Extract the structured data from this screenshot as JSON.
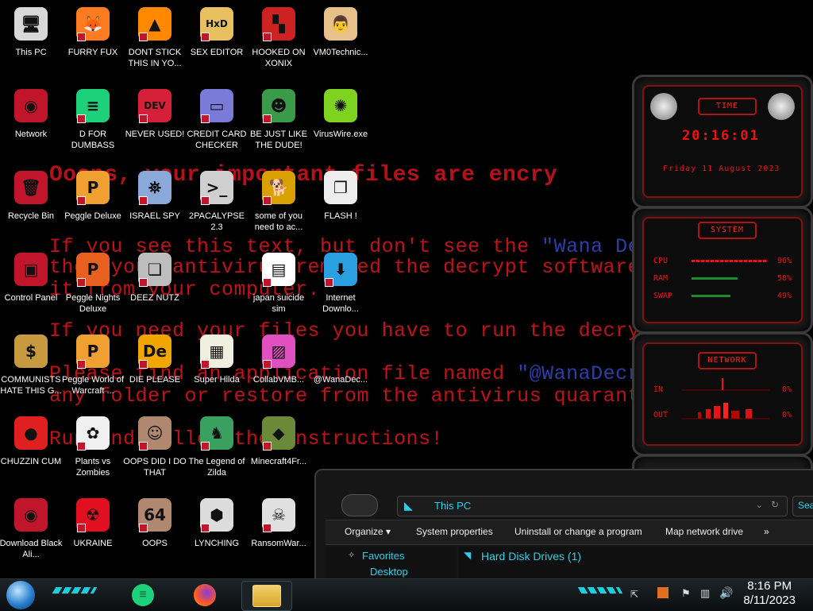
{
  "desktop": {
    "ransom_lines": [
      {
        "text": "Ooops, your important files are encry",
        "big": true
      },
      {
        "text": "If you see this text, but don't see the \"Wana Decryp",
        "highlight": "\"Wana Decryp"
      },
      {
        "text": "then your antivirus removed the decrypt software or"
      },
      {
        "text": "it from your computer."
      },
      {
        "text": "If you need your files you have to run the decrypt so"
      },
      {
        "text": "Please find an application file named \"@WanaDecrypto",
        "highlight": "\"@WanaDecrypto"
      },
      {
        "text": "any folder or restore from the antivirus quarantine."
      },
      {
        "text": "Run and follow the instructions!"
      }
    ],
    "icons": [
      {
        "label": "This PC",
        "icon": "computer-icon",
        "color": "#d8d8d8",
        "glyph": "🖥",
        "shortcut": false
      },
      {
        "label": "FURRY FUX",
        "icon": "firefox-icon",
        "color": "#ff7b1f",
        "glyph": "🦊",
        "shortcut": true
      },
      {
        "label": "DONT STICK THIS IN YO...",
        "icon": "vlc-cone-icon",
        "color": "#ff8800",
        "glyph": "▲",
        "shortcut": true
      },
      {
        "label": "SEX EDITOR",
        "icon": "hex-editor-icon",
        "color": "#e8c060",
        "glyph": "HxD",
        "shortcut": true
      },
      {
        "label": "HOOKED ON XONIX",
        "icon": "xonix-game-icon",
        "color": "#cc2222",
        "glyph": "▚",
        "shortcut": true
      },
      {
        "label": "VM0Technic...",
        "icon": "doctor-person-icon",
        "color": "#e8c08a",
        "glyph": "👨",
        "shortcut": false
      },
      {
        "label": "Network",
        "icon": "network-alien-icon",
        "color": "#c0152a",
        "glyph": "◉",
        "shortcut": false
      },
      {
        "label": "D FOR DUMBASS",
        "icon": "green-chat-icon",
        "color": "#1dd07a",
        "glyph": "≡",
        "shortcut": true
      },
      {
        "label": "NEVER USED!",
        "icon": "dev-cpp-icon",
        "color": "#d6203a",
        "glyph": "DEV",
        "shortcut": true
      },
      {
        "label": "CREDIT CARD CHECKER",
        "icon": "credit-card-icon",
        "color": "#7a7ad8",
        "glyph": "▭",
        "shortcut": true
      },
      {
        "label": "BE JUST LIKE THE DUDE!",
        "icon": "elf-character-icon",
        "color": "#3a9a4a",
        "glyph": "☻",
        "shortcut": true
      },
      {
        "label": "VirusWire.exe",
        "icon": "lime-icon",
        "color": "#7ed321",
        "glyph": "✺",
        "shortcut": false
      },
      {
        "label": "Recycle Bin",
        "icon": "recycle-bin-icon",
        "color": "#c0152a",
        "glyph": "🗑",
        "shortcut": false
      },
      {
        "label": "Peggle Deluxe",
        "icon": "peggle-icon",
        "color": "#f0a030",
        "glyph": "P",
        "shortcut": true
      },
      {
        "label": "ISRAEL SPY",
        "icon": "spy-network-icon",
        "color": "#8aa8d8",
        "glyph": "⛯",
        "shortcut": true
      },
      {
        "label": "2PACALYPSE 2.3",
        "icon": "terminal-icon",
        "color": "#cfcfcf",
        "glyph": ">_",
        "shortcut": true
      },
      {
        "label": "some of you need to ac...",
        "icon": "dog-icon",
        "color": "#d8a000",
        "glyph": "🐕",
        "shortcut": true
      },
      {
        "label": "FLASH !",
        "icon": "flash-cards-icon",
        "color": "#ededed",
        "glyph": "❐",
        "shortcut": false
      },
      {
        "label": "Control Panel",
        "icon": "control-panel-icon",
        "color": "#c0152a",
        "glyph": "▣",
        "shortcut": false
      },
      {
        "label": "Peggle Nights Deluxe",
        "icon": "peggle-nights-icon",
        "color": "#e86020",
        "glyph": "P",
        "shortcut": true
      },
      {
        "label": "DEEZ NUTZ",
        "icon": "stacked-windows-icon",
        "color": "#bdbdbd",
        "glyph": "❏",
        "shortcut": true
      },
      {
        "label": "",
        "icon": "blank",
        "color": "#000",
        "glyph": "",
        "shortcut": false
      },
      {
        "label": "japan suicide sim",
        "icon": "document-icon",
        "color": "#ffffff",
        "glyph": "▤",
        "shortcut": true
      },
      {
        "label": "Internet Downlo...",
        "icon": "download-manager-icon",
        "color": "#2aa0e0",
        "glyph": "⬇",
        "shortcut": true
      },
      {
        "label": "COMMUNISTS HATE THIS G...",
        "icon": "money-bag-icon",
        "color": "#c89a40",
        "glyph": "$",
        "shortcut": false
      },
      {
        "label": "Peggle World of Warcraft ...",
        "icon": "peggle-wow-icon",
        "color": "#f0a030",
        "glyph": "P",
        "shortcut": true
      },
      {
        "label": "DIE PLEASE",
        "icon": "de-icon",
        "color": "#f0a500",
        "glyph": "De",
        "shortcut": true
      },
      {
        "label": "Super Hilda",
        "icon": "pixel-character-icon",
        "color": "#f0f0e0",
        "glyph": "▦",
        "shortcut": true
      },
      {
        "label": "CollabVMB...",
        "icon": "picture-frames-icon",
        "color": "#e050c0",
        "glyph": "▨",
        "shortcut": true
      },
      {
        "label": "@WanaDec...",
        "icon": "blank",
        "color": "#000",
        "glyph": "",
        "shortcut": false
      },
      {
        "label": "CHUZZIN CUM",
        "icon": "chuzzle-icon",
        "color": "#e02020",
        "glyph": "●",
        "shortcut": false
      },
      {
        "label": "Plants vs Zombies",
        "icon": "flower-icon",
        "color": "#f0f0f0",
        "glyph": "✿",
        "shortcut": true
      },
      {
        "label": "OOPS DID I DO THAT",
        "icon": "portrait-icon",
        "color": "#b08870",
        "glyph": "☺",
        "shortcut": true
      },
      {
        "label": "The Legend of Zilda",
        "icon": "pixel-hero-icon",
        "color": "#3aa060",
        "glyph": "♞",
        "shortcut": true
      },
      {
        "label": "Minecraft4Fr...",
        "icon": "grass-block-icon",
        "color": "#6a8a3a",
        "glyph": "◆",
        "shortcut": true
      },
      {
        "label": "",
        "icon": "blank",
        "color": "#000",
        "glyph": "",
        "shortcut": false
      },
      {
        "label": "Download Black Ali...",
        "icon": "alien-download-icon",
        "color": "#c0152a",
        "glyph": "◉",
        "shortcut": false
      },
      {
        "label": "UKRAINE",
        "icon": "radiation-icon",
        "color": "#e01020",
        "glyph": "☢",
        "shortcut": true
      },
      {
        "label": "OOPS",
        "icon": "portrait-64-icon",
        "color": "#b08870",
        "glyph": "64",
        "shortcut": true
      },
      {
        "label": "LYNCHING",
        "icon": "gallows-icon",
        "color": "#dcdcdc",
        "glyph": "⬢",
        "shortcut": true
      },
      {
        "label": "RansomWar...",
        "icon": "skull-icon",
        "color": "#e0e0e0",
        "glyph": "☠",
        "shortcut": true
      },
      {
        "label": "",
        "icon": "blank",
        "color": "#000",
        "glyph": "",
        "shortcut": false
      }
    ]
  },
  "gadgets": {
    "time": {
      "title": "TIME",
      "time": "20:16:01",
      "date": "Friday 11 August 2023"
    },
    "system": {
      "title": "SYSTEM",
      "rows": [
        {
          "label": "CPU",
          "value": "96%",
          "level": 0.96
        },
        {
          "label": "RAM",
          "value": "58%",
          "level": 0.58
        },
        {
          "label": "SWAP",
          "value": "49%",
          "level": 0.49
        }
      ]
    },
    "network": {
      "title": "NETWORK",
      "rows": [
        {
          "label": "IN",
          "value": "0%"
        },
        {
          "label": "OUT",
          "value": "0%"
        }
      ]
    }
  },
  "explorer": {
    "address": "This PC",
    "search_placeholder": "Sear",
    "toolbar": [
      "Organize ▾",
      "System properties",
      "Uninstall or change a program",
      "Map network drive",
      "»"
    ],
    "nav": [
      "Favorites",
      "Desktop"
    ],
    "group_header": "Hard Disk Drives (1)"
  },
  "taskbar": {
    "time": "8:16 PM",
    "date": "8/11/2023"
  },
  "colors": {
    "accent_red": "#c0152a",
    "accent_cyan": "#2ad0e8"
  }
}
